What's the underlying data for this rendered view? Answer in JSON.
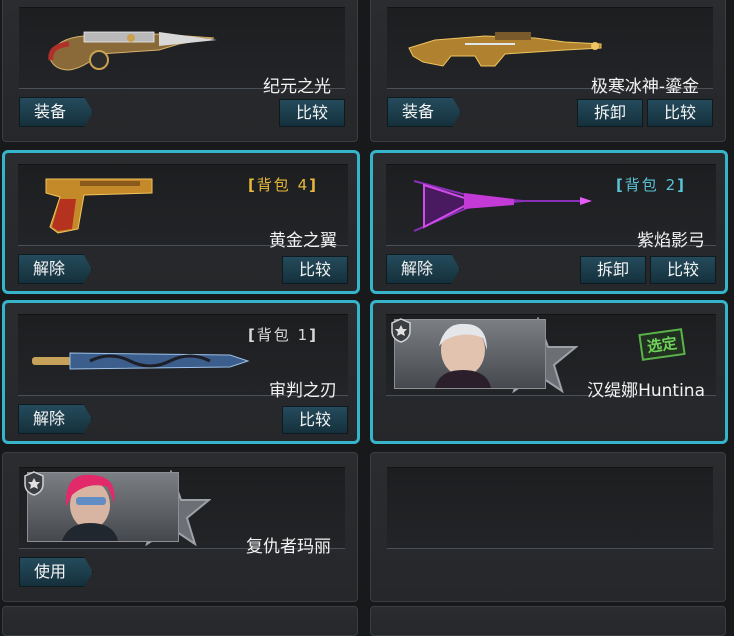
{
  "cards": {
    "c1": {
      "name": "纪元之光",
      "btn_left": "装备",
      "btn_compare": "比较",
      "weapon_icon": "energy-blaster-icon"
    },
    "c2": {
      "name": "极寒冰神-鎏金",
      "btn_left": "装备",
      "btn_remove": "拆卸",
      "btn_compare": "比较",
      "weapon_icon": "gold-rifle-icon"
    },
    "c3": {
      "name": "黄金之翼",
      "bag_label": "背包",
      "bag_num": "4",
      "btn_left": "解除",
      "btn_compare": "比较",
      "weapon_icon": "gold-pistol-icon"
    },
    "c4": {
      "name": "紫焰影弓",
      "bag_label": "背包",
      "bag_num": "2",
      "btn_left": "解除",
      "btn_remove": "拆卸",
      "btn_compare": "比较",
      "weapon_icon": "purple-crossbow-icon"
    },
    "c5": {
      "name": "审判之刃",
      "bag_label": "背包",
      "bag_num": "1",
      "btn_left": "解除",
      "btn_compare": "比较",
      "weapon_icon": "blade-icon"
    },
    "c6": {
      "name": "汉缇娜Huntina",
      "stamp": "选定",
      "portrait_icon": "white-hair-girl-avatar"
    },
    "c7": {
      "name": "复仇者玛丽",
      "btn_left": "使用",
      "portrait_icon": "red-hair-girl-avatar"
    },
    "c8": {}
  },
  "colors": {
    "selected_border": "#36b4c9",
    "bag_gold": "#e8b93a",
    "bag_cyan": "#5bc3d6",
    "stamp_green": "#5bb24a"
  }
}
